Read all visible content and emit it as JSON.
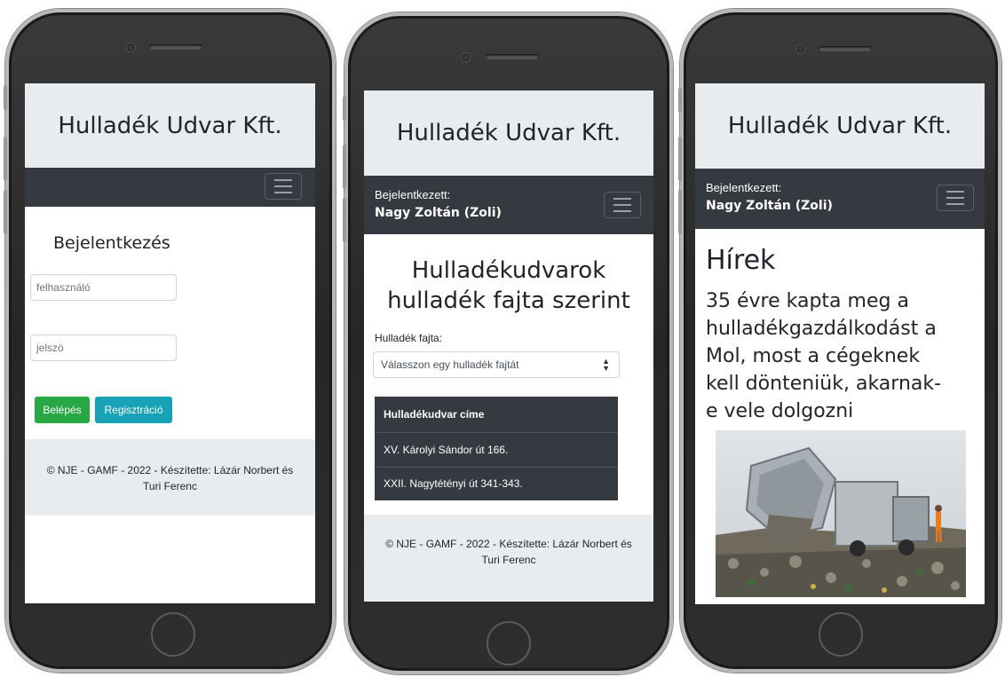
{
  "brand": "Hulladék Udvar Kft.",
  "logged_in": {
    "label": "Bejelentkezett:",
    "user": "Nagy Zoltán (Zoli)"
  },
  "footer": {
    "line1": "© NJE - GAMF - 2022 - Készítette: Lázár Norbert és",
    "line2": "Turi Ferenc"
  },
  "login": {
    "title": "Bejelentkezés",
    "username_placeholder": "felhasználó",
    "password_placeholder": "jelszó",
    "login_button": "Belépés",
    "register_button": "Regisztráció"
  },
  "yards": {
    "title_line1": "Hulladékudvarok",
    "title_line2": "hulladék fajta szerint",
    "select_label": "Hulladék fajta:",
    "select_value": "Válasszon egy hulladék fajtát",
    "table_header": "Hulladékudvar címe",
    "rows": [
      "XV. Károlyi Sándor út 166.",
      "XXII. Nagytétényi út 341-343."
    ]
  },
  "news": {
    "title": "Hírek",
    "headline_lines": [
      "35 évre kapta meg a",
      "hulladékgazdálkodást a",
      "Mol, most a cégeknek",
      "kell dönteniük, akarnak-",
      "e vele dolgozni"
    ]
  },
  "icons": {
    "menu": "hamburger-menu-icon",
    "select": "sort-arrows-icon",
    "news_image": "garbage-truck-landfill-image"
  },
  "colors": {
    "brand_bg": "#e9ecef",
    "navbar_bg": "#343a40",
    "success": "#28a745",
    "info": "#17a2b8",
    "table_dark": "#343a40"
  }
}
